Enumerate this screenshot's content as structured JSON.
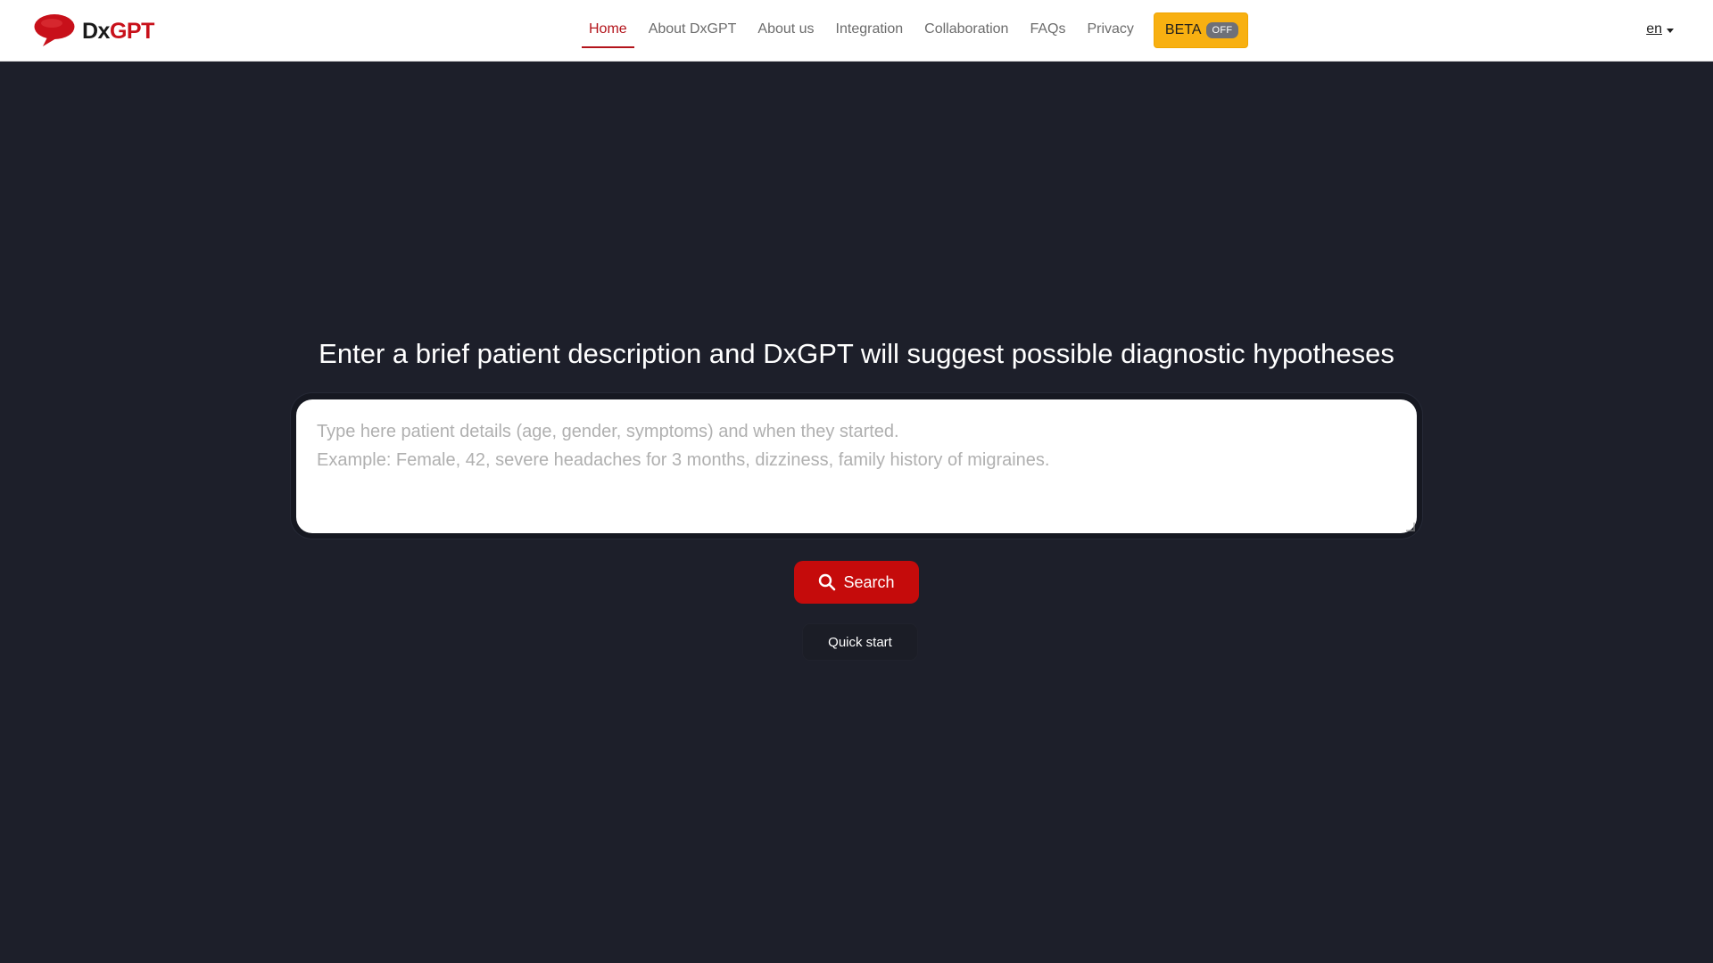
{
  "brand": {
    "name_part1": "Dx",
    "name_part2": "GPT",
    "color_primary": "#c8101a",
    "icon": "speech-bubble-logo-icon"
  },
  "nav": {
    "items": [
      {
        "label": "Home",
        "active": true
      },
      {
        "label": "About DxGPT",
        "active": false
      },
      {
        "label": "About us",
        "active": false
      },
      {
        "label": "Integration",
        "active": false
      },
      {
        "label": "Collaboration",
        "active": false
      },
      {
        "label": "FAQs",
        "active": false
      },
      {
        "label": "Privacy",
        "active": false
      }
    ],
    "beta": {
      "label": "BETA",
      "state": "OFF",
      "color": "#f8b011"
    },
    "language": "en"
  },
  "main": {
    "headline": "Enter a brief patient description and DxGPT will suggest possible diagnostic hypotheses",
    "input": {
      "value": "",
      "placeholder": "Type here patient details (age, gender, symptoms) and when they started.\nExample: Female, 42, severe headaches for 3 months, dizziness, family history of migraines."
    },
    "search_button": {
      "label": "Search",
      "icon": "search-icon",
      "color": "#c50b0b"
    },
    "quick_start_label": "Quick start"
  },
  "theme": {
    "background": "#1d1f2a",
    "nav_background": "#ffffff",
    "active_color": "#b3141b"
  }
}
